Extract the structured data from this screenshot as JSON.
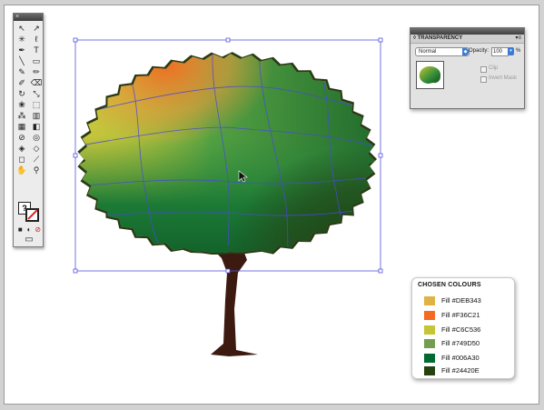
{
  "tools_panel": {
    "close_glyph": "×",
    "tools": [
      {
        "name": "selection-tool-icon",
        "glyph": "↖"
      },
      {
        "name": "direct-selection-tool-icon",
        "glyph": "↗"
      },
      {
        "name": "magic-wand-tool-icon",
        "glyph": "✳"
      },
      {
        "name": "lasso-tool-icon",
        "glyph": "ℓ"
      },
      {
        "name": "pen-tool-icon",
        "glyph": "✒"
      },
      {
        "name": "type-tool-icon",
        "glyph": "T"
      },
      {
        "name": "line-tool-icon",
        "glyph": "╲"
      },
      {
        "name": "rectangle-tool-icon",
        "glyph": "▭"
      },
      {
        "name": "paintbrush-tool-icon",
        "glyph": "✎"
      },
      {
        "name": "pencil-tool-icon",
        "glyph": "✏"
      },
      {
        "name": "blob-brush-tool-icon",
        "glyph": "✐"
      },
      {
        "name": "eraser-tool-icon",
        "glyph": "⌫"
      },
      {
        "name": "rotate-tool-icon",
        "glyph": "↻"
      },
      {
        "name": "scale-tool-icon",
        "glyph": "⤡"
      },
      {
        "name": "warp-tool-icon",
        "glyph": "❀"
      },
      {
        "name": "free-transform-tool-icon",
        "glyph": "⬚"
      },
      {
        "name": "symbol-sprayer-tool-icon",
        "glyph": "⁂"
      },
      {
        "name": "column-graph-tool-icon",
        "glyph": "▥"
      },
      {
        "name": "mesh-tool-icon",
        "glyph": "▦"
      },
      {
        "name": "gradient-tool-icon",
        "glyph": "◧"
      },
      {
        "name": "eyedropper-tool-icon",
        "glyph": "⊘"
      },
      {
        "name": "blend-tool-icon",
        "glyph": "◎"
      },
      {
        "name": "live-paint-bucket-tool-icon",
        "glyph": "◈"
      },
      {
        "name": "live-paint-selection-tool-icon",
        "glyph": "◇"
      },
      {
        "name": "artboard-tool-icon",
        "glyph": "◻"
      },
      {
        "name": "slice-tool-icon",
        "glyph": "⟋"
      },
      {
        "name": "hand-tool-icon",
        "glyph": "✋"
      },
      {
        "name": "zoom-tool-icon",
        "glyph": "⚲"
      }
    ],
    "fill_glyph": "?",
    "mode_glyphs": [
      "■",
      "◐",
      "⊘"
    ],
    "screen_mode_glyph": "▭"
  },
  "transparency_panel": {
    "tab_label": "◊ TRANSPARENCY",
    "menu_glyph": "▾≡",
    "blend_mode": "Normal",
    "opacity_label": "Opacity:",
    "opacity_value": "100",
    "opacity_unit": "%",
    "clip_label": "Clip",
    "invert_mask_label": "Invert Mask"
  },
  "chosen_colours": {
    "title": "CHOSEN COLOURS",
    "swatches": [
      {
        "label": "Fill  #DEB343",
        "color": "#DEB343"
      },
      {
        "label": "Fill  #F36C21",
        "color": "#F36C21"
      },
      {
        "label": "Fill  #C6C536",
        "color": "#C6C536"
      },
      {
        "label": "Fill  #749D50",
        "color": "#749D50"
      },
      {
        "label": "Fill  #006A30",
        "color": "#006A30"
      },
      {
        "label": "Fill  #24420E",
        "color": "#24420E"
      }
    ]
  },
  "colors": {
    "selection": "#4a4ad8",
    "trunk": "#3d1a10",
    "foliage_light": "#c8c63c",
    "foliage_orange": "#e8782a",
    "foliage_mid": "#2e8a3a",
    "foliage_dark": "#1f4a18"
  },
  "cursor_icon": "arrow-pointer-icon"
}
